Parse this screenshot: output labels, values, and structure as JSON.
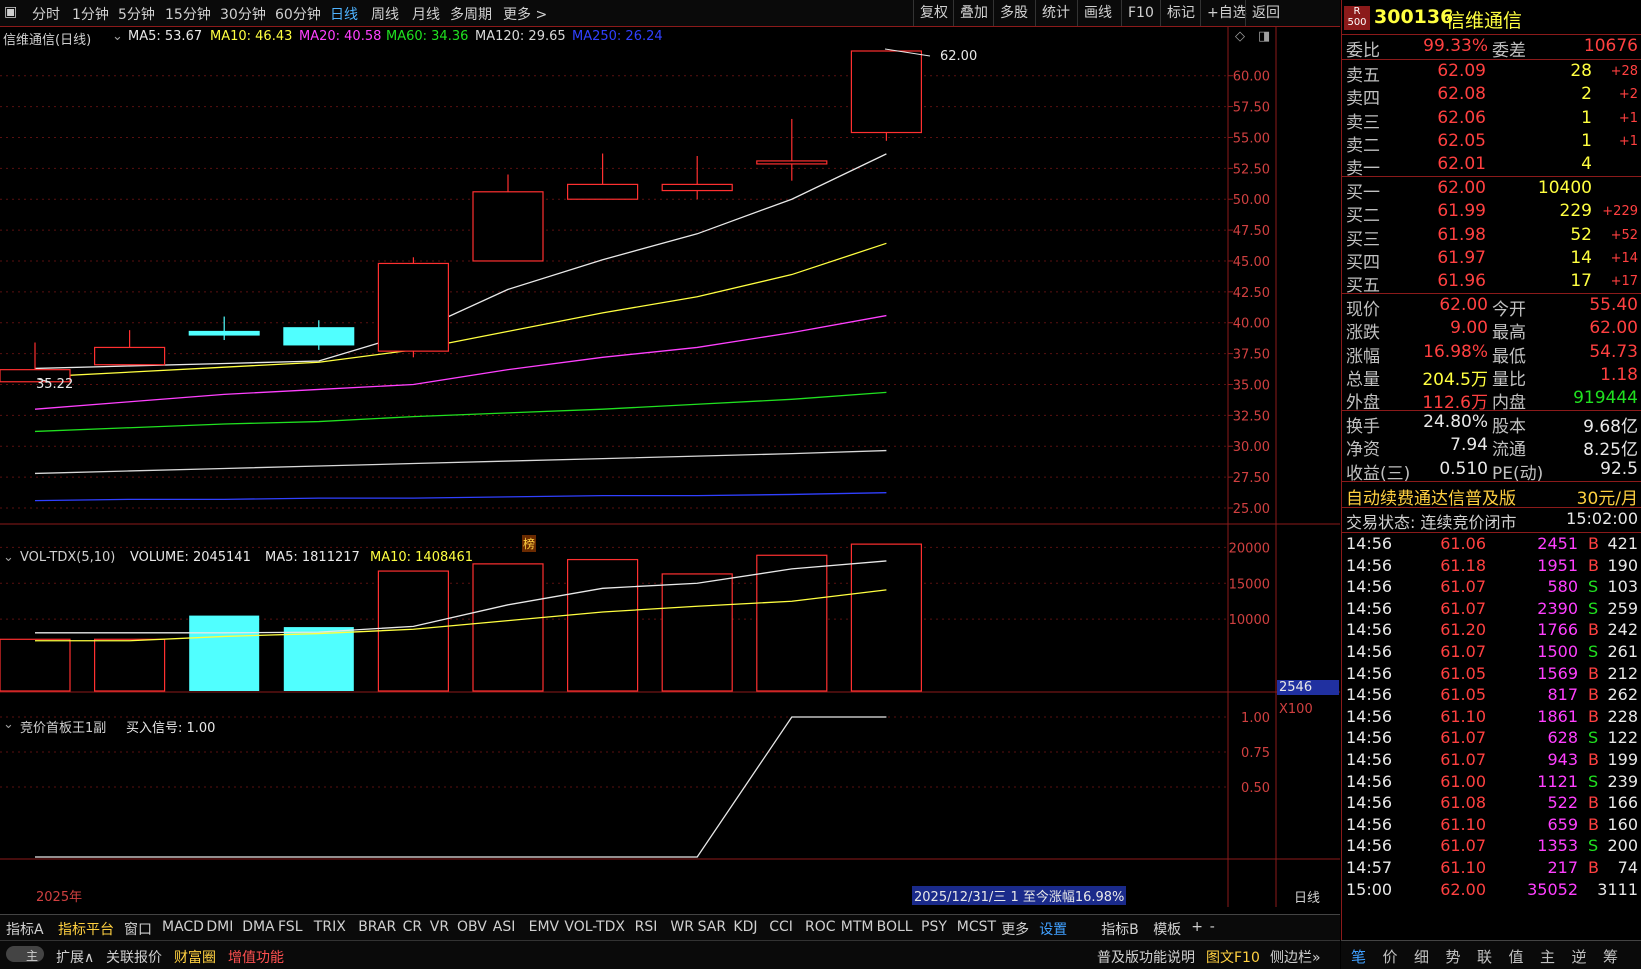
{
  "toolbar": {
    "periods": [
      "分时",
      "1分钟",
      "5分钟",
      "15分钟",
      "30分钟",
      "60分钟",
      "日线",
      "周线",
      "月线",
      "多周期",
      "更多 >"
    ],
    "active_period": "日线",
    "right_buttons": [
      "复权",
      "叠加",
      "多股",
      "统计",
      "画线",
      "F10",
      "标记",
      "+自选",
      "返回"
    ]
  },
  "legend": {
    "name": "信维通信(日线)",
    "ma5": "MA5: 53.67",
    "ma10": "MA10: 46.43",
    "ma20": "MA20: 40.58",
    "ma60": "MA60: 34.36",
    "ma120": "MA120: 29.65",
    "ma250": "MA250: 26.24"
  },
  "price_axis": [
    "60.00",
    "57.50",
    "55.00",
    "52.50",
    "50.00",
    "47.50",
    "45.00",
    "42.50",
    "40.00",
    "37.50",
    "35.00",
    "32.50",
    "30.00",
    "27.50",
    "25.00"
  ],
  "high_label": "62.00",
  "low_label": "35.22",
  "bang_label": "榜",
  "vol_legend": {
    "name": "VOL-TDX(5,10)",
    "volume": "VOLUME: 2045141",
    "ma5": "MA5: 1811217",
    "ma10": "MA10: 1408461"
  },
  "vol_axis": [
    "20000",
    "15000",
    "10000"
  ],
  "vol_cursor": "2546",
  "vol_unit": "X100",
  "ind_legend": {
    "name": "竞价首板王1副",
    "signal": "买入信号: 1.00"
  },
  "ind_axis": [
    "1.00",
    "0.75",
    "0.50"
  ],
  "year_label": "2025年",
  "status_info": "2025/12/31/三 1 至今涨幅16.98%",
  "period_tag": "日线",
  "chart_data": [
    {
      "type": "candlestick",
      "candles": [
        {
          "open": 35.22,
          "close": 36.2,
          "high": 38.4,
          "low": 35.22,
          "up": true
        },
        {
          "open": 36.6,
          "close": 38.0,
          "high": 39.4,
          "low": 36.6,
          "up": true
        },
        {
          "open": 39.3,
          "close": 39.0,
          "high": 40.5,
          "low": 38.6,
          "up": false
        },
        {
          "open": 39.6,
          "close": 38.2,
          "high": 40.2,
          "low": 37.8,
          "up": false
        },
        {
          "open": 37.7,
          "close": 44.8,
          "high": 45.3,
          "low": 37.2,
          "up": true
        },
        {
          "open": 45.0,
          "close": 50.6,
          "high": 52.0,
          "low": 45.0,
          "up": true
        },
        {
          "open": 50.0,
          "close": 51.2,
          "high": 53.7,
          "low": 50.0,
          "up": true
        },
        {
          "open": 50.7,
          "close": 51.2,
          "high": 53.5,
          "low": 50.0,
          "up": true
        },
        {
          "open": 53.0,
          "close": 53.1,
          "high": 56.5,
          "low": 51.5,
          "up": true
        },
        {
          "open": 55.4,
          "close": 62.0,
          "high": 62.0,
          "low": 54.73,
          "up": true
        }
      ],
      "ma_lines": [
        {
          "name": "MA5",
          "color": "#e8e8e8",
          "values": [
            36.3,
            36.5,
            36.7,
            36.9,
            39.2,
            42.7,
            45.1,
            47.2,
            50.0,
            53.67
          ]
        },
        {
          "name": "MA10",
          "color": "#ffff40",
          "values": [
            35.6,
            36.0,
            36.4,
            36.8,
            37.8,
            39.3,
            40.8,
            42.1,
            43.9,
            46.43
          ]
        },
        {
          "name": "MA20",
          "color": "#ff40ff",
          "values": [
            33.0,
            33.6,
            34.2,
            34.6,
            35.0,
            36.2,
            37.2,
            38.0,
            39.2,
            40.58
          ]
        },
        {
          "name": "MA60",
          "color": "#20e020",
          "values": [
            31.2,
            31.5,
            31.8,
            32.0,
            32.4,
            32.7,
            33.0,
            33.4,
            33.8,
            34.36
          ]
        },
        {
          "name": "MA120",
          "color": "#d8d8d8",
          "values": [
            27.8,
            28.0,
            28.2,
            28.4,
            28.6,
            28.8,
            29.0,
            29.2,
            29.4,
            29.65
          ]
        },
        {
          "name": "MA250",
          "color": "#3040ff",
          "values": [
            25.6,
            25.7,
            25.7,
            25.8,
            25.8,
            25.9,
            26.0,
            26.0,
            26.1,
            26.24
          ]
        }
      ],
      "ylim": [
        25.0,
        62.0
      ]
    },
    {
      "type": "bar",
      "volumes": [
        7200,
        7200,
        10500,
        8900,
        16700,
        17700,
        18300,
        16300,
        18900,
        20451
      ],
      "up": [
        true,
        true,
        false,
        false,
        true,
        true,
        true,
        true,
        true,
        true
      ],
      "ma_lines": [
        {
          "name": "MA5",
          "color": "#e8e8e8",
          "values": [
            8100,
            8100,
            8100,
            8200,
            9000,
            12000,
            14300,
            15000,
            17000,
            18112
          ]
        },
        {
          "name": "MA10",
          "color": "#ffff40",
          "values": [
            7000,
            7000,
            7600,
            8000,
            8600,
            9800,
            11000,
            11800,
            12500,
            14085
          ]
        }
      ],
      "ylim": [
        0,
        22000
      ]
    },
    {
      "type": "line",
      "values": [
        0,
        0,
        0,
        0,
        0,
        0,
        0,
        0,
        1,
        1
      ],
      "ylim": [
        0,
        1.2
      ]
    }
  ],
  "quote": {
    "code_badge_top": "R",
    "code_badge_bot": "500",
    "code": "300136",
    "name": "信维通信",
    "wb_label": "委比",
    "wb_val": "99.33%",
    "wc_label": "委差",
    "wc_val": "10676",
    "sells": [
      {
        "label": "卖五",
        "price": "62.09",
        "vol": "28",
        "chg": "+28"
      },
      {
        "label": "卖四",
        "price": "62.08",
        "vol": "2",
        "chg": "+2"
      },
      {
        "label": "卖三",
        "price": "62.06",
        "vol": "1",
        "chg": "+1"
      },
      {
        "label": "卖二",
        "price": "62.05",
        "vol": "1",
        "chg": "+1"
      },
      {
        "label": "卖一",
        "price": "62.01",
        "vol": "4",
        "chg": ""
      }
    ],
    "buys": [
      {
        "label": "买一",
        "price": "62.00",
        "vol": "10400",
        "chg": ""
      },
      {
        "label": "买二",
        "price": "61.99",
        "vol": "229",
        "chg": "+229"
      },
      {
        "label": "买三",
        "price": "61.98",
        "vol": "52",
        "chg": "+52"
      },
      {
        "label": "买四",
        "price": "61.97",
        "vol": "14",
        "chg": "+14"
      },
      {
        "label": "买五",
        "price": "61.96",
        "vol": "17",
        "chg": "+17"
      }
    ],
    "stats1": [
      {
        "l1": "现价",
        "v1": "62.00",
        "l2": "今开",
        "v2": "55.40"
      },
      {
        "l1": "涨跌",
        "v1": "9.00",
        "l2": "最高",
        "v2": "62.00"
      },
      {
        "l1": "涨幅",
        "v1": "16.98%",
        "l2": "最低",
        "v2": "54.73"
      },
      {
        "l1": "总量",
        "v1": "204.5万",
        "l2": "量比",
        "v2": "1.18"
      },
      {
        "l1": "外盘",
        "v1": "112.6万",
        "l2": "内盘",
        "v2": "919444"
      }
    ],
    "stats2": [
      {
        "l1": "换手",
        "v1": "24.80%",
        "l2": "股本",
        "v2": "9.68亿"
      },
      {
        "l1": "净资",
        "v1": "7.94",
        "l2": "流通",
        "v2": "8.25亿"
      },
      {
        "l1": "收益(三)",
        "v1": "0.510",
        "l2": "PE(动)",
        "v2": "92.5"
      }
    ],
    "promo": "自动续费通达信普及版",
    "promo_price": "30元/月",
    "trade_status": "交易状态: 连续竞价闭市",
    "trade_time": "15:02:00",
    "ticks": [
      {
        "t": "14:56",
        "p": "61.06",
        "v": "2451",
        "s": "B",
        "n": "421"
      },
      {
        "t": "14:56",
        "p": "61.18",
        "v": "1951",
        "s": "B",
        "n": "190"
      },
      {
        "t": "14:56",
        "p": "61.07",
        "v": "580",
        "s": "S",
        "n": "103"
      },
      {
        "t": "14:56",
        "p": "61.07",
        "v": "2390",
        "s": "S",
        "n": "259"
      },
      {
        "t": "14:56",
        "p": "61.20",
        "v": "1766",
        "s": "B",
        "n": "242"
      },
      {
        "t": "14:56",
        "p": "61.07",
        "v": "1500",
        "s": "S",
        "n": "261"
      },
      {
        "t": "14:56",
        "p": "61.05",
        "v": "1569",
        "s": "B",
        "n": "212"
      },
      {
        "t": "14:56",
        "p": "61.05",
        "v": "817",
        "s": "B",
        "n": "262"
      },
      {
        "t": "14:56",
        "p": "61.10",
        "v": "1861",
        "s": "B",
        "n": "228"
      },
      {
        "t": "14:56",
        "p": "61.07",
        "v": "628",
        "s": "S",
        "n": "122"
      },
      {
        "t": "14:56",
        "p": "61.07",
        "v": "943",
        "s": "B",
        "n": "199"
      },
      {
        "t": "14:56",
        "p": "61.00",
        "v": "1121",
        "s": "S",
        "n": "239"
      },
      {
        "t": "14:56",
        "p": "61.08",
        "v": "522",
        "s": "B",
        "n": "166"
      },
      {
        "t": "14:56",
        "p": "61.10",
        "v": "659",
        "s": "B",
        "n": "160"
      },
      {
        "t": "14:56",
        "p": "61.07",
        "v": "1353",
        "s": "S",
        "n": "200"
      },
      {
        "t": "14:57",
        "p": "61.10",
        "v": "217",
        "s": "B",
        "n": "74"
      },
      {
        "t": "15:00",
        "p": "62.00",
        "v": "35052",
        "s": "",
        "n": "3111"
      }
    ],
    "bottom_tabs": [
      "笔",
      "价",
      "细",
      "势",
      "联",
      "值",
      "主",
      "逆",
      "筹"
    ]
  },
  "indicator_tabs": [
    "指标A",
    "指标平台",
    "窗口",
    "MACD",
    "DMI",
    "DMA",
    "FSL",
    "TRIX",
    "BRAR",
    "CR",
    "VR",
    "OBV",
    "ASI",
    "EMV",
    "VOL-TDX",
    "RSI",
    "WR",
    "SAR",
    "KDJ",
    "CCI",
    "ROC",
    "MTM",
    "BOLL",
    "PSY",
    "MCST",
    "更多",
    "设置",
    "指标B",
    "模板",
    "+",
    "-"
  ],
  "bottom2": {
    "toggle": "主",
    "items": [
      "扩展∧",
      "关联报价",
      "财富圈",
      "增值功能"
    ],
    "right_items": [
      "普及版功能说明",
      "图文F10",
      "侧边栏»"
    ]
  },
  "colors": {
    "up": "#ff3030",
    "down_fill": "#50ffff",
    "grid": "#8b1a1a",
    "axis_text": "#d04040"
  }
}
